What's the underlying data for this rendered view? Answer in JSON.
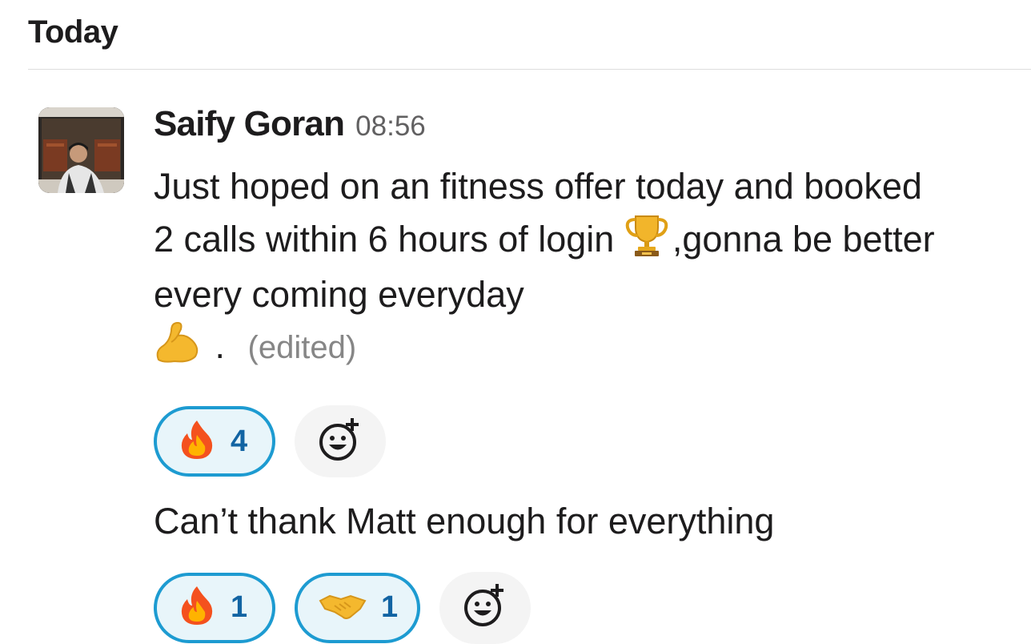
{
  "day": {
    "label": "Today"
  },
  "message": {
    "author": "Saify Goran",
    "time": "08:56",
    "line1": "Just hoped on an fitness offer today and booked 2 calls within 6 hours of login",
    "line2": ",gonna be better every coming everyday",
    "line3": ".",
    "edited_label": "(edited)",
    "inline_emojis": [
      "trophy-emoji",
      "flexed-biceps-emoji"
    ],
    "reactions": [
      {
        "emoji": "fire-emoji",
        "count": "4"
      }
    ]
  },
  "message2": {
    "text": "Can’t thank Matt enough for everything",
    "reactions": [
      {
        "emoji": "fire-emoji",
        "count": "1"
      },
      {
        "emoji": "handshake-emoji",
        "count": "1"
      }
    ]
  },
  "colors": {
    "reaction_border": "#1d9bd1",
    "reaction_bg": "#e8f5fa",
    "reaction_count": "#1264a3",
    "timestamp": "#616061",
    "edited": "#868686"
  }
}
